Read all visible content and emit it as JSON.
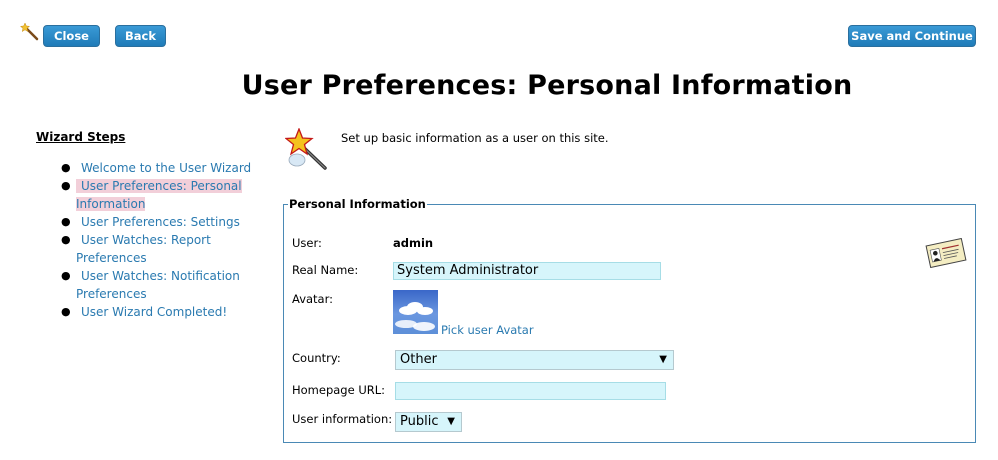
{
  "toolbar": {
    "close_label": "Close",
    "back_label": "Back",
    "save_label": "Save and Continue"
  },
  "page_title": "User Preferences: Personal Information",
  "sidebar": {
    "title": "Wizard Steps",
    "items": [
      {
        "label": "Welcome to the User Wizard",
        "active": false
      },
      {
        "label": "User Preferences: Personal Information",
        "active": true
      },
      {
        "label": "User Preferences: Settings",
        "active": false
      },
      {
        "label": "User Watches: Report Preferences",
        "active": false
      },
      {
        "label": "User Watches: Notification Preferences",
        "active": false
      },
      {
        "label": "User Wizard Completed!",
        "active": false
      }
    ]
  },
  "intro_text": "Set up basic information as a user on this site.",
  "form": {
    "legend": "Personal Information",
    "user_label": "User:",
    "user_value": "admin",
    "realname_label": "Real Name:",
    "realname_value": "System Administrator",
    "avatar_label": "Avatar:",
    "avatar_link": "Pick user Avatar",
    "country_label": "Country:",
    "country_value": "Other",
    "homepage_label": "Homepage URL:",
    "homepage_value": "",
    "userinfo_label": "User information:",
    "userinfo_value": "Public"
  },
  "colors": {
    "accent": "#1f7bb8",
    "link": "#2a7ab0",
    "active_step_bg": "#f2cfd9",
    "input_bg": "#d6f5fb"
  }
}
